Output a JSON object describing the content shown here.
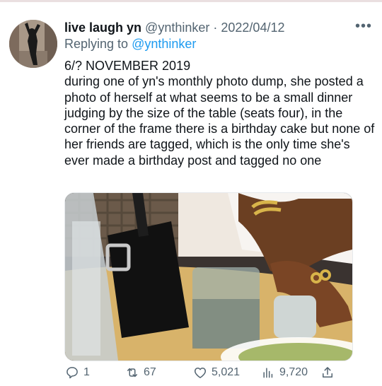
{
  "tweet": {
    "display_name": "live laugh yn",
    "handle": "@ynthinker",
    "separator": "·",
    "date": "2022/04/12",
    "replying_prefix": "Replying to",
    "replying_to": "@ynthinker",
    "more_label": "•••",
    "lines": [
      "6/? NOVEMBER 2019",
      "during one of yn's monthly photo dump, she posted a photo of herself at what seems to be a small dinner judging by the size of the table (seats four), in the corner of the frame there is a birthday cake but none of her friends are tagged, which is the only time she's ever made a birthday post and tagged no one"
    ]
  },
  "actions": {
    "replies": "1",
    "retweets": "67",
    "likes": "5,021",
    "views": "9,720"
  },
  "icons": {
    "reply": "comment-bubble-icon",
    "retweet": "retweet-icon",
    "like": "heart-icon",
    "views": "bar-chart-icon",
    "share": "share-upload-icon",
    "more": "more-dots-icon"
  },
  "colors": {
    "link": "#1d9bf0",
    "muted": "#536471",
    "text": "#0f1419"
  }
}
